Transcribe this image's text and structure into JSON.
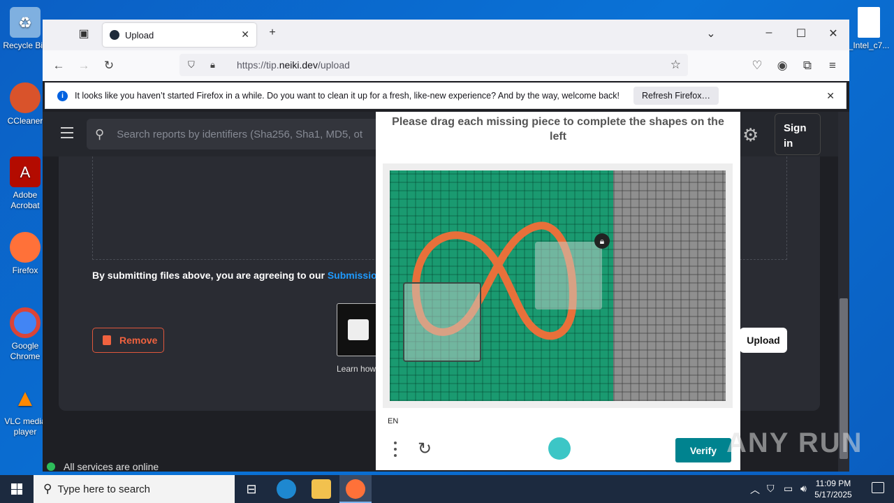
{
  "desktop": {
    "icons": [
      {
        "label": "Recycle Bin",
        "color": "#7fb0e0"
      },
      {
        "label": "CCleaner",
        "color": "#d9532b"
      },
      {
        "label": "Adobe Acrobat",
        "color": "#b30b00"
      },
      {
        "label": "Firefox",
        "color": "#ff7139"
      },
      {
        "label": "Google Chrome",
        "color": "#4285f4"
      },
      {
        "label": "VLC media player",
        "color": "#ff8800"
      }
    ],
    "right_icon_label": "_Intel_c7..."
  },
  "browser": {
    "tab_title": "Upload",
    "url_prefix": "https://tip.",
    "url_domain": "neiki.dev",
    "url_path": "/upload",
    "notification": {
      "text": "It looks like you haven’t started Firefox in a while. Do you want to clean it up for a fresh, like-new experience? And by the way, welcome back!",
      "button": "Refresh Firefox…"
    }
  },
  "site": {
    "search_placeholder": "Search reports by identifiers (Sha256, Sha1, MD5, ot",
    "signin_label": "Sign in",
    "terms_text": "By submitting files above, you are agreeing to our ",
    "terms_link": "Submission",
    "remove_label": "Remove",
    "learn_text": "Learn how",
    "upload_label": "Upload",
    "status_text": "All services are online"
  },
  "captcha": {
    "instruction": "Please drag each missing piece to complete the shapes on the left",
    "language": "EN",
    "verify_label": "Verify",
    "colors": {
      "left_bg": "#1a9a70",
      "right_bg": "#8f8f8f",
      "verify": "#00838f"
    }
  },
  "taskbar": {
    "search_placeholder": "Type here to search",
    "time": "11:09 PM",
    "date": "5/17/2025"
  },
  "watermark": "ANY RUN"
}
